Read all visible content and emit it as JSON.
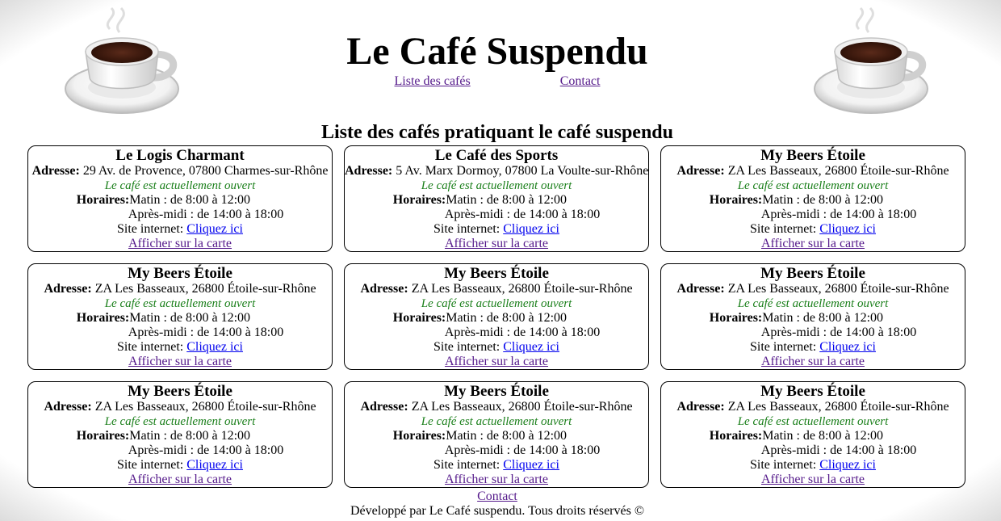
{
  "header": {
    "title": "Le Café Suspendu",
    "nav": [
      {
        "label": "Liste des cafés"
      },
      {
        "label": "Contact"
      }
    ]
  },
  "list_title": "Liste des cafés pratiquant le café suspendu",
  "labels": {
    "address": "Adresse:",
    "hours": "Horaires:",
    "website": "Site internet:",
    "website_link": "Cliquez ici",
    "map_link": "Afficher sur la carte"
  },
  "cafes": [
    {
      "name": "Le Logis Charmant",
      "address": "29 Av. de Provence, 07800 Charmes-sur-Rhône",
      "status": "Le café est actuellement ouvert",
      "morning": "Matin : de 8:00 à 12:00",
      "afternoon": "Après-midi : de 14:00 à 18:00"
    },
    {
      "name": "Le Café des Sports",
      "address": "5 Av. Marx Dormoy, 07800 La Voulte-sur-Rhône",
      "status": "Le café est actuellement ouvert",
      "morning": "Matin : de 8:00 à 12:00",
      "afternoon": "Après-midi : de 14:00 à 18:00"
    },
    {
      "name": "My Beers Étoile",
      "address": "ZA Les Basseaux, 26800 Étoile-sur-Rhône",
      "status": "Le café est actuellement ouvert",
      "morning": "Matin : de 8:00 à 12:00",
      "afternoon": "Après-midi : de 14:00 à 18:00"
    },
    {
      "name": "My Beers Étoile",
      "address": "ZA Les Basseaux, 26800 Étoile-sur-Rhône",
      "status": "Le café est actuellement ouvert",
      "morning": "Matin : de 8:00 à 12:00",
      "afternoon": "Après-midi : de 14:00 à 18:00"
    },
    {
      "name": "My Beers Étoile",
      "address": "ZA Les Basseaux, 26800 Étoile-sur-Rhône",
      "status": "Le café est actuellement ouvert",
      "morning": "Matin : de 8:00 à 12:00",
      "afternoon": "Après-midi : de 14:00 à 18:00"
    },
    {
      "name": "My Beers Étoile",
      "address": "ZA Les Basseaux, 26800 Étoile-sur-Rhône",
      "status": "Le café est actuellement ouvert",
      "morning": "Matin : de 8:00 à 12:00",
      "afternoon": "Après-midi : de 14:00 à 18:00"
    },
    {
      "name": "My Beers Étoile",
      "address": "ZA Les Basseaux, 26800 Étoile-sur-Rhône",
      "status": "Le café est actuellement ouvert",
      "morning": "Matin : de 8:00 à 12:00",
      "afternoon": "Après-midi : de 14:00 à 18:00"
    },
    {
      "name": "My Beers Étoile",
      "address": "ZA Les Basseaux, 26800 Étoile-sur-Rhône",
      "status": "Le café est actuellement ouvert",
      "morning": "Matin : de 8:00 à 12:00",
      "afternoon": "Après-midi : de 14:00 à 18:00"
    },
    {
      "name": "My Beers Étoile",
      "address": "ZA Les Basseaux, 26800 Étoile-sur-Rhône",
      "status": "Le café est actuellement ouvert",
      "morning": "Matin : de 8:00 à 12:00",
      "afternoon": "Après-midi : de 14:00 à 18:00"
    }
  ],
  "footer": {
    "contact": "Contact",
    "copyright": "Développé par Le Café suspendu. Tous droits réservés ©"
  },
  "colors": {
    "status_open": "#1a7f1a",
    "link": "#0000ee",
    "visited_link": "#551a8b"
  }
}
